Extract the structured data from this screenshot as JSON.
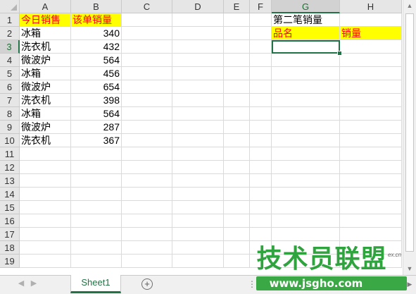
{
  "columns": [
    "A",
    "B",
    "C",
    "D",
    "E",
    "F",
    "G",
    "H"
  ],
  "selected_column": "G",
  "row_numbers": [
    "1",
    "2",
    "3",
    "4",
    "5",
    "6",
    "7",
    "8",
    "9",
    "10",
    "11",
    "12",
    "13",
    "14",
    "15",
    "16",
    "17",
    "18",
    "19"
  ],
  "selected_row": "3",
  "cells": {
    "A1": "今日销售",
    "B1": "该单销量",
    "A2": "冰箱",
    "B2": "340",
    "A3": "洗衣机",
    "B3": "432",
    "A4": "微波炉",
    "B4": "564",
    "A5": "冰箱",
    "B5": "456",
    "A6": "微波炉",
    "B6": "654",
    "A7": "洗衣机",
    "B7": "398",
    "A8": "冰箱",
    "B8": "564",
    "A9": "微波炉",
    "B9": "287",
    "A10": "洗衣机",
    "B10": "367",
    "G1": "第二笔销量",
    "G2": "品名",
    "H2": "销量"
  },
  "highlighted_cells": [
    "A1",
    "B1",
    "G2",
    "H2"
  ],
  "active_cell": "G3",
  "sheet_tabs": [
    "Sheet1"
  ],
  "active_sheet": "Sheet1",
  "watermark": {
    "title": "技术员联盟",
    "url": "www.jsgho.com",
    "badge": "ex.cn"
  },
  "colors": {
    "highlight_fill": "#ffff00",
    "highlight_text": "#ff0000",
    "accent": "#217346"
  }
}
